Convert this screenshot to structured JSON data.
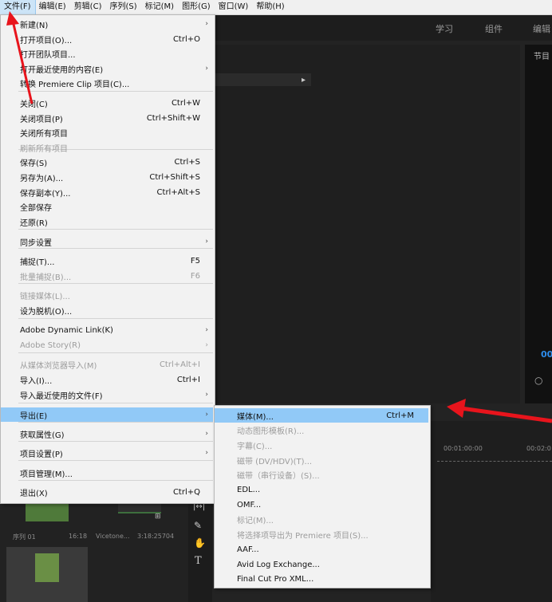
{
  "menubar": {
    "items": [
      "文件(F)",
      "编辑(E)",
      "剪辑(C)",
      "序列(S)",
      "标记(M)",
      "图形(G)",
      "窗口(W)",
      "帮助(H)"
    ]
  },
  "workspace": {
    "tabs": [
      "学习",
      "组件",
      "编辑"
    ]
  },
  "panels": {
    "program_title": "节目",
    "timecode_partial": "00",
    "ruler_a": "00:01:00:00",
    "ruler_b": "00:02:0",
    "thumb1_label": "序列 01",
    "thumb1_dur": "16:18",
    "thumb2_label": "Vicetone...",
    "thumb2_dur": "3:18:25704"
  },
  "file_menu": {
    "items": [
      {
        "label": "新建(N)",
        "shortcut": "",
        "submenu": true,
        "disabled": false
      },
      {
        "label": "打开项目(O)...",
        "shortcut": "Ctrl+O",
        "submenu": false,
        "disabled": false
      },
      {
        "label": "打开团队项目...",
        "shortcut": "",
        "submenu": false,
        "disabled": false
      },
      {
        "label": "打开最近使用的内容(E)",
        "shortcut": "",
        "submenu": true,
        "disabled": false
      },
      {
        "label": "转换 Premiere Clip 项目(C)...",
        "shortcut": "",
        "submenu": false,
        "disabled": false
      },
      {
        "label": "关闭(C)",
        "shortcut": "Ctrl+W",
        "submenu": false,
        "disabled": false
      },
      {
        "label": "关闭项目(P)",
        "shortcut": "Ctrl+Shift+W",
        "submenu": false,
        "disabled": false
      },
      {
        "label": "关闭所有项目",
        "shortcut": "",
        "submenu": false,
        "disabled": false
      },
      {
        "label": "刷新所有项目",
        "shortcut": "",
        "submenu": false,
        "disabled": true
      },
      {
        "label": "保存(S)",
        "shortcut": "Ctrl+S",
        "submenu": false,
        "disabled": false
      },
      {
        "label": "另存为(A)...",
        "shortcut": "Ctrl+Shift+S",
        "submenu": false,
        "disabled": false
      },
      {
        "label": "保存副本(Y)...",
        "shortcut": "Ctrl+Alt+S",
        "submenu": false,
        "disabled": false
      },
      {
        "label": "全部保存",
        "shortcut": "",
        "submenu": false,
        "disabled": false
      },
      {
        "label": "还原(R)",
        "shortcut": "",
        "submenu": false,
        "disabled": false
      },
      {
        "label": "同步设置",
        "shortcut": "",
        "submenu": true,
        "disabled": false
      },
      {
        "label": "捕捉(T)...",
        "shortcut": "F5",
        "submenu": false,
        "disabled": false
      },
      {
        "label": "批量捕捉(B)...",
        "shortcut": "F6",
        "submenu": false,
        "disabled": true
      },
      {
        "label": "链接媒体(L)...",
        "shortcut": "",
        "submenu": false,
        "disabled": true
      },
      {
        "label": "设为脱机(O)...",
        "shortcut": "",
        "submenu": false,
        "disabled": false
      },
      {
        "label": "Adobe Dynamic Link(K)",
        "shortcut": "",
        "submenu": true,
        "disabled": false
      },
      {
        "label": "Adobe Story(R)",
        "shortcut": "",
        "submenu": true,
        "disabled": true
      },
      {
        "label": "从媒体浏览器导入(M)",
        "shortcut": "Ctrl+Alt+I",
        "submenu": false,
        "disabled": true
      },
      {
        "label": "导入(I)...",
        "shortcut": "Ctrl+I",
        "submenu": false,
        "disabled": false
      },
      {
        "label": "导入最近使用的文件(F)",
        "shortcut": "",
        "submenu": true,
        "disabled": false
      },
      {
        "label": "导出(E)",
        "shortcut": "",
        "submenu": true,
        "disabled": false,
        "highlighted": true
      },
      {
        "label": "获取属性(G)",
        "shortcut": "",
        "submenu": true,
        "disabled": false
      },
      {
        "label": "项目设置(P)",
        "shortcut": "",
        "submenu": true,
        "disabled": false
      },
      {
        "label": "项目管理(M)...",
        "shortcut": "",
        "submenu": false,
        "disabled": false
      },
      {
        "label": "退出(X)",
        "shortcut": "Ctrl+Q",
        "submenu": false,
        "disabled": false
      }
    ]
  },
  "export_menu": {
    "items": [
      {
        "label": "媒体(M)...",
        "shortcut": "Ctrl+M",
        "disabled": false,
        "highlighted": true
      },
      {
        "label": "动态图形模板(R)...",
        "shortcut": "",
        "disabled": true
      },
      {
        "label": "字幕(C)...",
        "shortcut": "",
        "disabled": true
      },
      {
        "label": "磁带 (DV/HDV)(T)...",
        "shortcut": "",
        "disabled": true
      },
      {
        "label": "磁带（串行设备）(S)...",
        "shortcut": "",
        "disabled": true
      },
      {
        "label": "EDL...",
        "shortcut": "",
        "disabled": false
      },
      {
        "label": "OMF...",
        "shortcut": "",
        "disabled": false
      },
      {
        "label": "标记(M)...",
        "shortcut": "",
        "disabled": true
      },
      {
        "label": "将选择项导出为 Premiere 项目(S)...",
        "shortcut": "",
        "disabled": true
      },
      {
        "label": "AAF...",
        "shortcut": "",
        "disabled": false
      },
      {
        "label": "Avid Log Exchange...",
        "shortcut": "",
        "disabled": false
      },
      {
        "label": "Final Cut Pro XML...",
        "shortcut": "",
        "disabled": false
      }
    ]
  },
  "colors": {
    "highlight": "#91c9f7",
    "annotation": "#e8141c"
  }
}
